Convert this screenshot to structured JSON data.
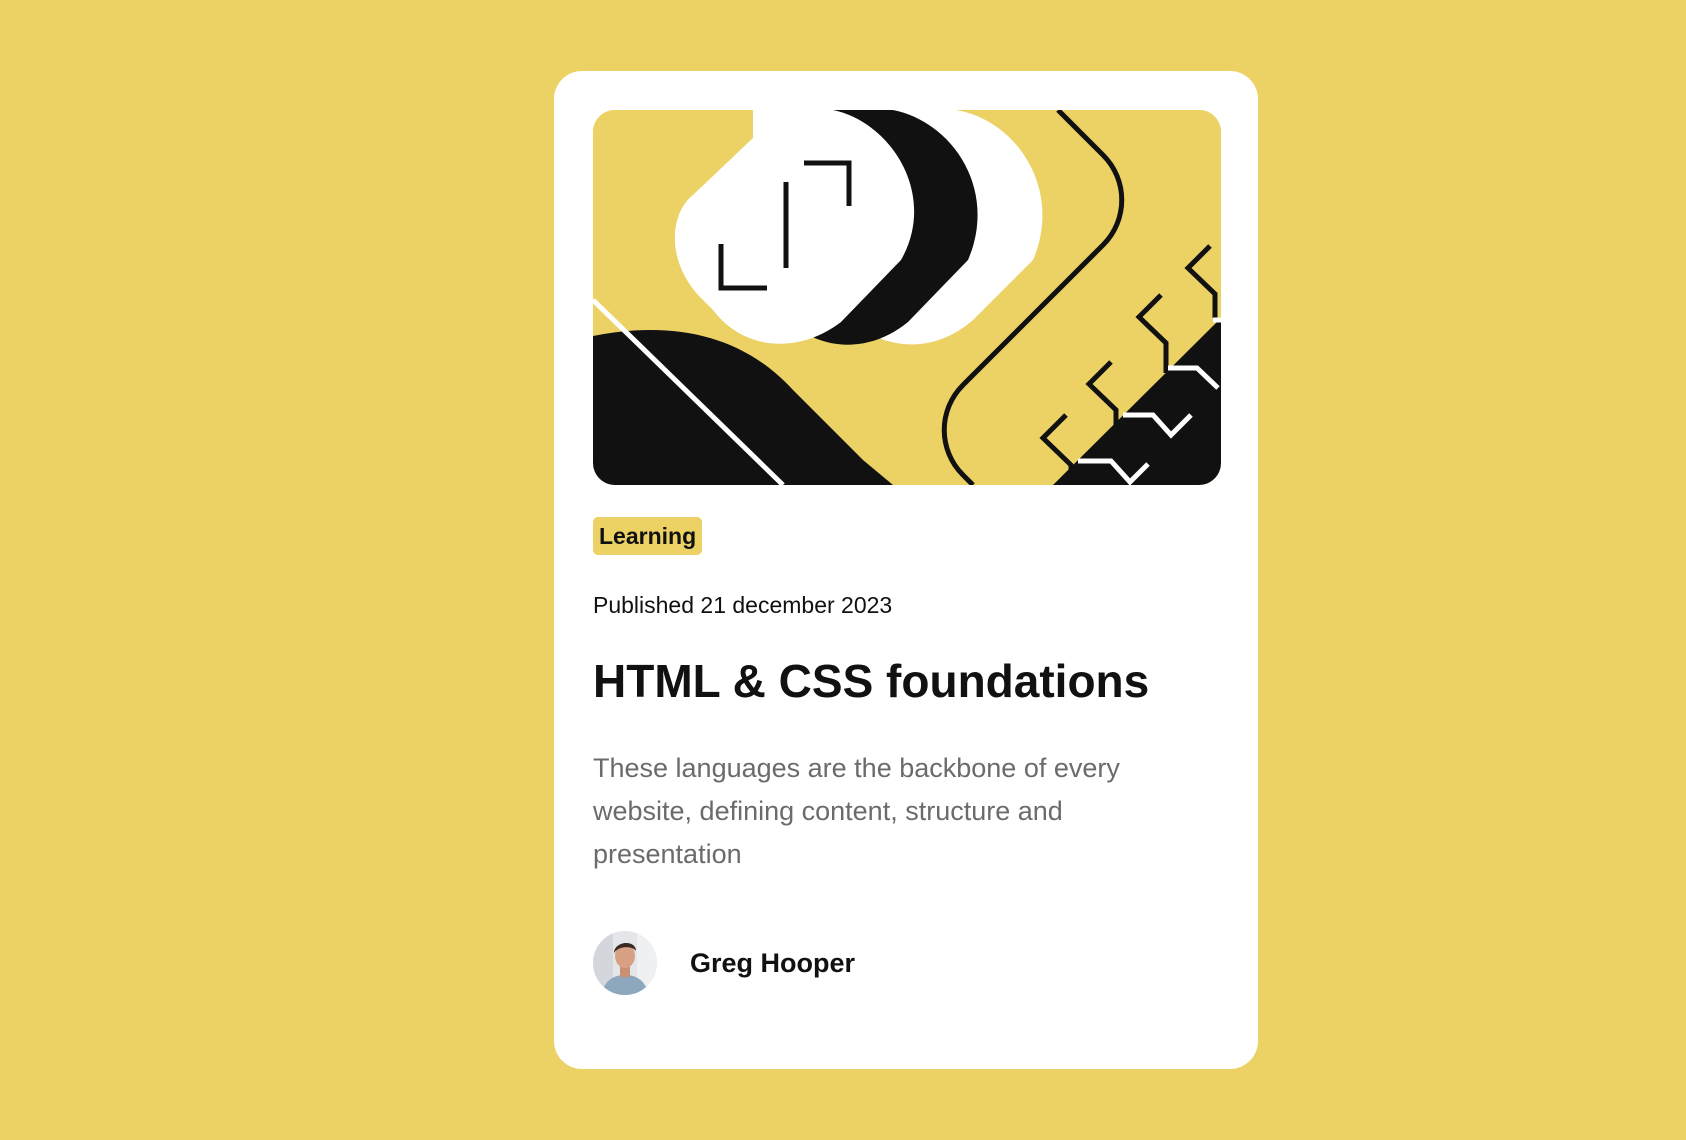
{
  "card": {
    "tag": "Learning",
    "published": "Published 21 december 2023",
    "title": "HTML & CSS foundations",
    "excerpt": "These languages are the backbone of every website, defining content, structure and presentation",
    "author": {
      "name": "Greg Hooper"
    }
  },
  "colors": {
    "background": "#ECD165",
    "card": "#FFFFFF",
    "text": "#111111",
    "muted_text": "#6B6B6B"
  },
  "icons": {
    "hero": "illustration-article",
    "avatar": "avatar-greg-hooper"
  }
}
